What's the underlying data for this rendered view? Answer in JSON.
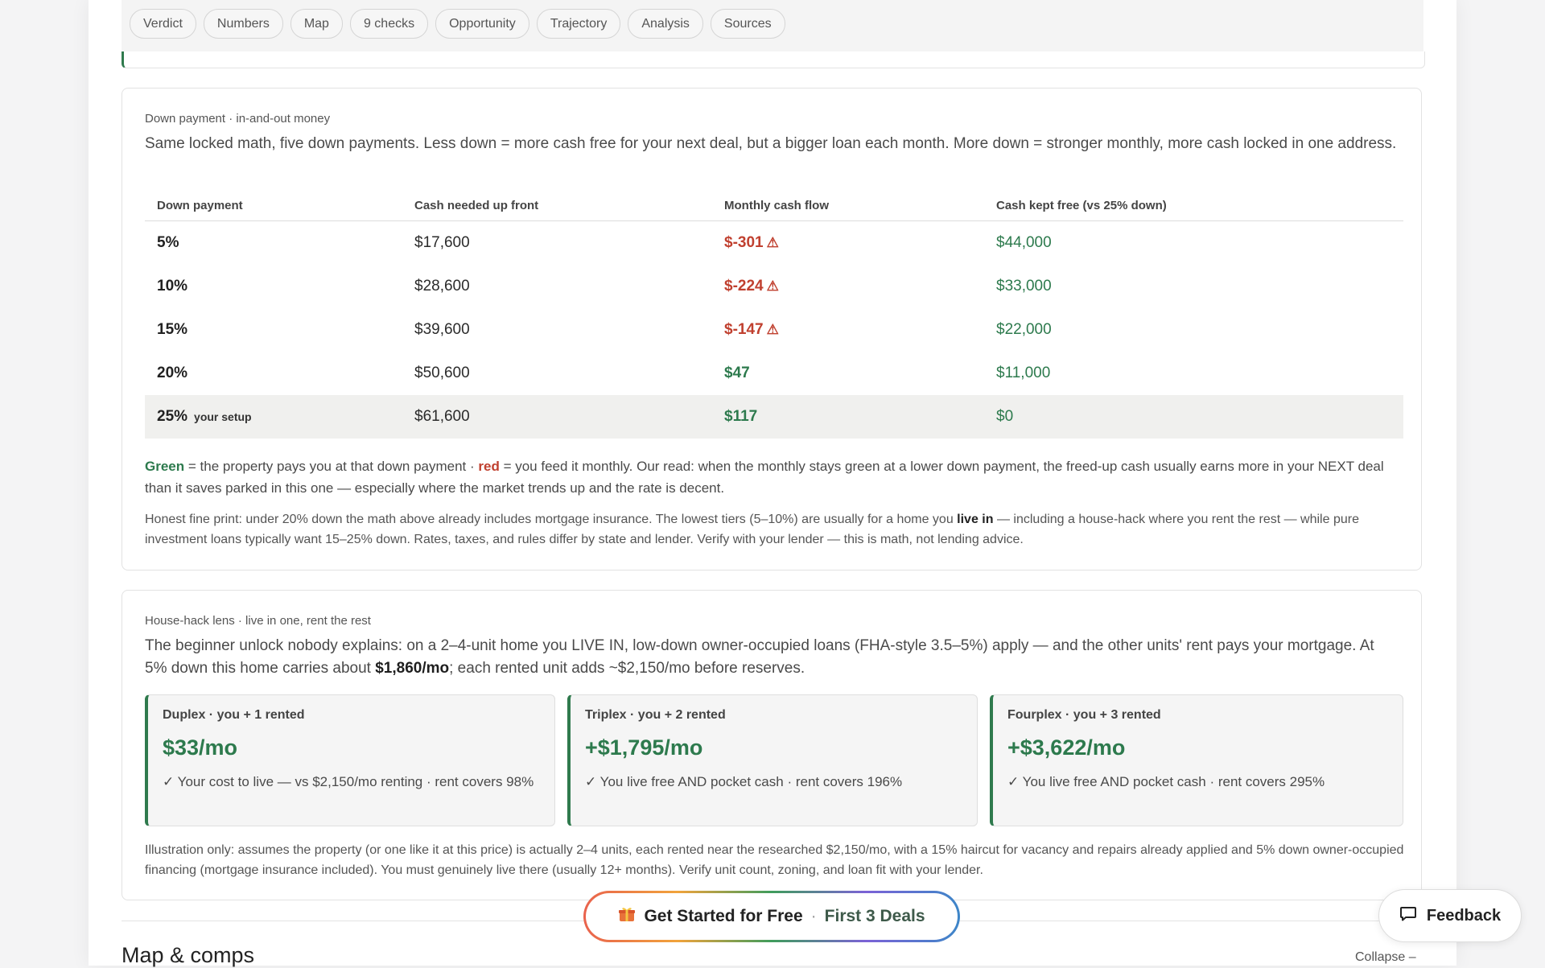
{
  "nav": {
    "chips": [
      "Verdict",
      "Numbers",
      "Map",
      "9 checks",
      "Opportunity",
      "Trajectory",
      "Analysis",
      "Sources"
    ]
  },
  "down_payment": {
    "eyebrow": "Down payment · in-and-out money",
    "lead": "Same locked math, five down payments. Less down = more cash free for your next deal, but a bigger loan each month. More down = stronger monthly, more cash locked in one address.",
    "headers": [
      "Down payment",
      "Cash needed up front",
      "Monthly cash flow",
      "Cash kept free (vs 25% down)"
    ],
    "rows": [
      {
        "dp": "5%",
        "tag": "",
        "cash": "$17,600",
        "flow": "$-301",
        "flow_status": "negative",
        "free": "$44,000"
      },
      {
        "dp": "10%",
        "tag": "",
        "cash": "$28,600",
        "flow": "$-224",
        "flow_status": "negative",
        "free": "$33,000"
      },
      {
        "dp": "15%",
        "tag": "",
        "cash": "$39,600",
        "flow": "$-147",
        "flow_status": "negative",
        "free": "$22,000"
      },
      {
        "dp": "20%",
        "tag": "",
        "cash": "$50,600",
        "flow": "$47",
        "flow_status": "positive",
        "free": "$11,000"
      },
      {
        "dp": "25%",
        "tag": "your setup",
        "cash": "$61,600",
        "flow": "$117",
        "flow_status": "positive",
        "free": "$0"
      }
    ],
    "warn_glyph": "⚠",
    "legend_green": "Green",
    "legend_mid": " = the property pays you at that down payment · ",
    "legend_red": "red",
    "legend_rest": " = you feed it monthly. Our read: when the monthly stays green at a lower down payment, the freed-up cash usually earns more in your NEXT deal than it saves parked in this one — especially where the market trends up and the rate is decent.",
    "fine_a": "Honest fine print: under 20% down the math above already includes mortgage insurance. The lowest tiers (5–10%) are usually for a home you ",
    "fine_bold": "live in",
    "fine_b": " — including a house-hack where you rent the rest — while pure investment loans typically want 15–25% down. Rates, taxes, and rules differ by state and lender. Verify with your lender — this is math, not lending advice."
  },
  "house_hack": {
    "eyebrow": "House-hack lens · live in one, rent the rest",
    "lead_a": "The beginner unlock nobody explains: on a 2–4-unit home you LIVE IN, low-down owner-occupied loans (FHA-style 3.5–5%) apply — and the other units' rent pays your mortgage. At 5% down this home carries about ",
    "lead_bold": "$1,860/mo",
    "lead_b": "; each rented unit adds ~$2,150/mo before reserves.",
    "boxes": [
      {
        "title": "Duplex · you + 1 rented",
        "value": "$33/mo",
        "desc": "✓ Your cost to live — vs $2,150/mo renting · rent covers 98%"
      },
      {
        "title": "Triplex · you + 2 rented",
        "value": "+$1,795/mo",
        "desc": "✓ You live free AND pocket cash · rent covers 196%"
      },
      {
        "title": "Fourplex · you + 3 rented",
        "value": "+$3,622/mo",
        "desc": "✓ You live free AND pocket cash · rent covers 295%"
      }
    ],
    "note": "Illustration only: assumes the property (or one like it at this price) is actually 2–4 units, each rented near the researched $2,150/mo, with a 15% haircut for vacancy and repairs already applied and 5% down owner-occupied financing (mortgage insurance included). You must genuinely live there (usually 12+ months). Verify unit count, zoning, and loan fit with your lender."
  },
  "map_section": {
    "title": "Map & comps",
    "collapse": "Collapse –"
  },
  "cta": {
    "icon": "gift-icon",
    "label": "Get Started for Free",
    "sep": "·",
    "sub": "First 3 Deals"
  },
  "feedback": {
    "label": "Feedback",
    "icon": "chat-bubble-icon"
  },
  "colors": {
    "positive": "#2d7a4d",
    "negative": "#c0402f"
  }
}
